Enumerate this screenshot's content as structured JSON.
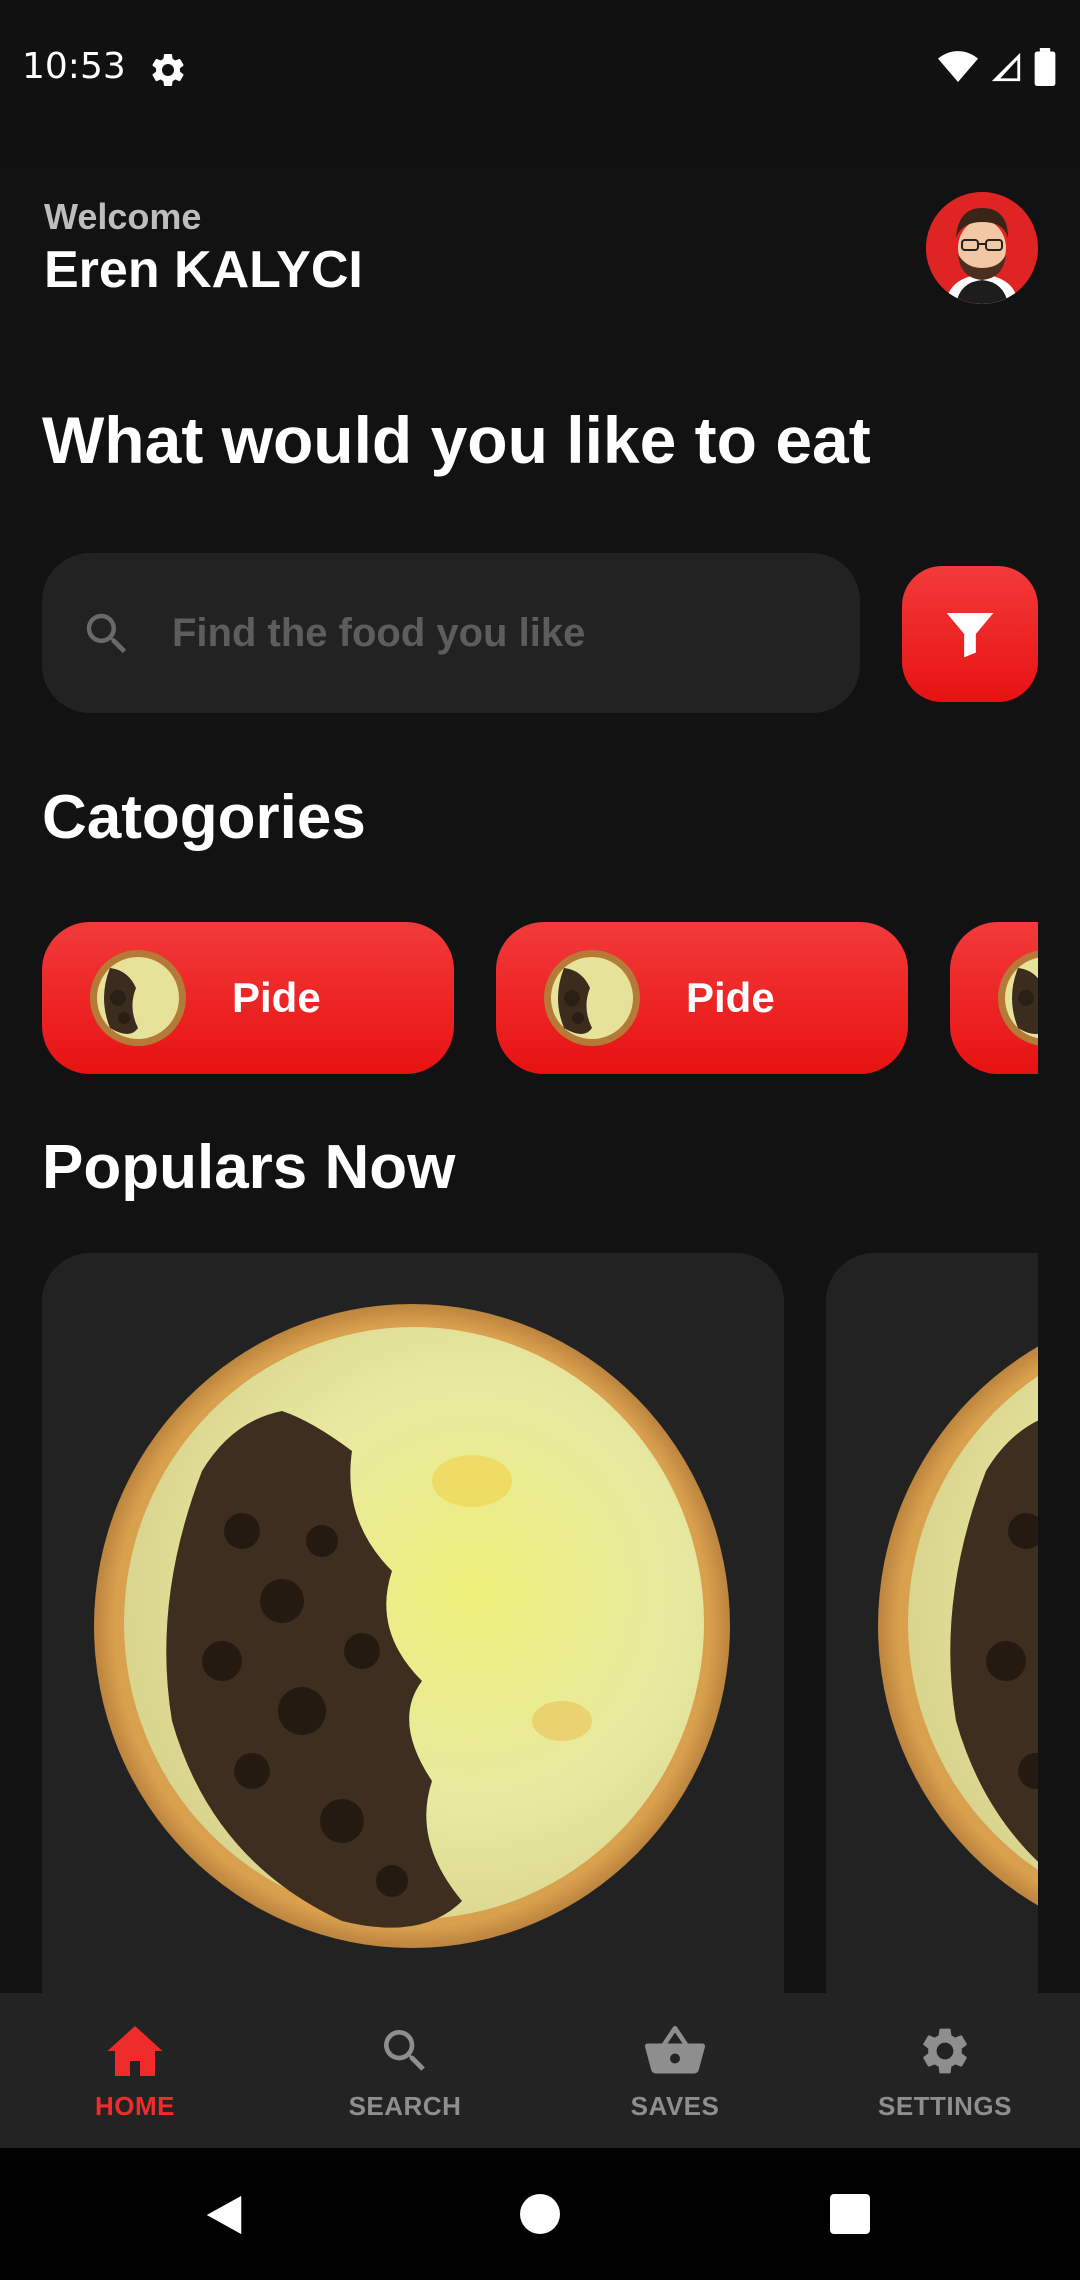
{
  "status_bar": {
    "time": "10:53"
  },
  "header": {
    "welcome": "Welcome",
    "user_name": "Eren KALYCI"
  },
  "headline": "What would you like to eat",
  "search": {
    "placeholder": "Find the food you like"
  },
  "categories": {
    "title": "Catogories",
    "items": [
      {
        "label": "Pide"
      },
      {
        "label": "Pide"
      },
      {
        "label": ""
      }
    ]
  },
  "populars": {
    "title": "Populars Now"
  },
  "bottom_nav": {
    "items": [
      {
        "label": "HOME",
        "icon": "home-icon",
        "active": true
      },
      {
        "label": "SEARCH",
        "icon": "search-icon",
        "active": false
      },
      {
        "label": "SAVES",
        "icon": "basket-icon",
        "active": false
      },
      {
        "label": "SETTINGS",
        "icon": "gear-icon",
        "active": false
      }
    ]
  },
  "colors": {
    "accent": "#ef2b2b",
    "background": "#131213",
    "surface": "#232223",
    "nav_inactive": "#8f8e8f"
  }
}
